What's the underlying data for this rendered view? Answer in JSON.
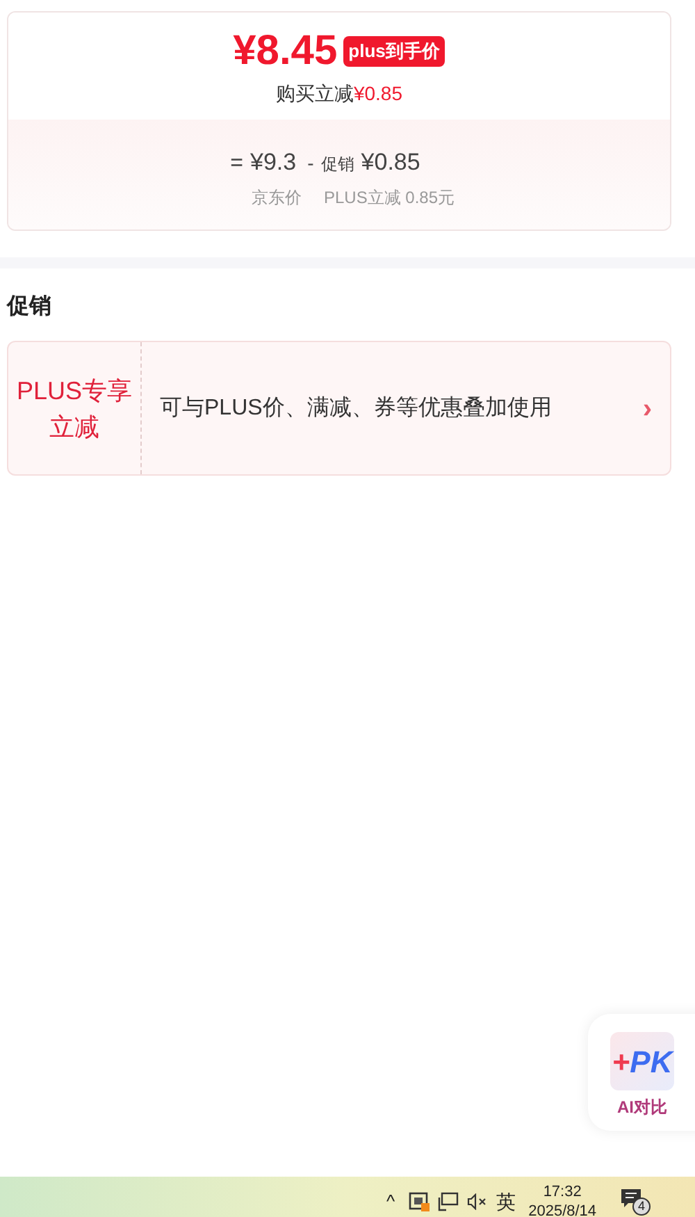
{
  "price_card": {
    "price": "¥8.45",
    "badge": "plus到手价",
    "saving_label": "购买立减",
    "saving_amount": "¥0.85",
    "equals": "=",
    "base_price": "¥9.3",
    "minus": "-",
    "promo_label": "促销",
    "promo_amount": "¥0.85",
    "base_caption": "京东价",
    "promo_caption": "PLUS立减 0.85元"
  },
  "promotions": {
    "title": "促销",
    "items": [
      {
        "tag": "PLUS专享立减",
        "description": "可与PLUS价、满减、券等优惠叠加使用",
        "chevron": "›"
      }
    ]
  },
  "ai_compare": {
    "logo_plus": "+",
    "logo_pk": "PK",
    "label": "AI对比"
  },
  "taskbar": {
    "tray_caret": "^",
    "ime": "英",
    "time": "17:32",
    "date": "2025/8/14",
    "notification_count": "4"
  }
}
